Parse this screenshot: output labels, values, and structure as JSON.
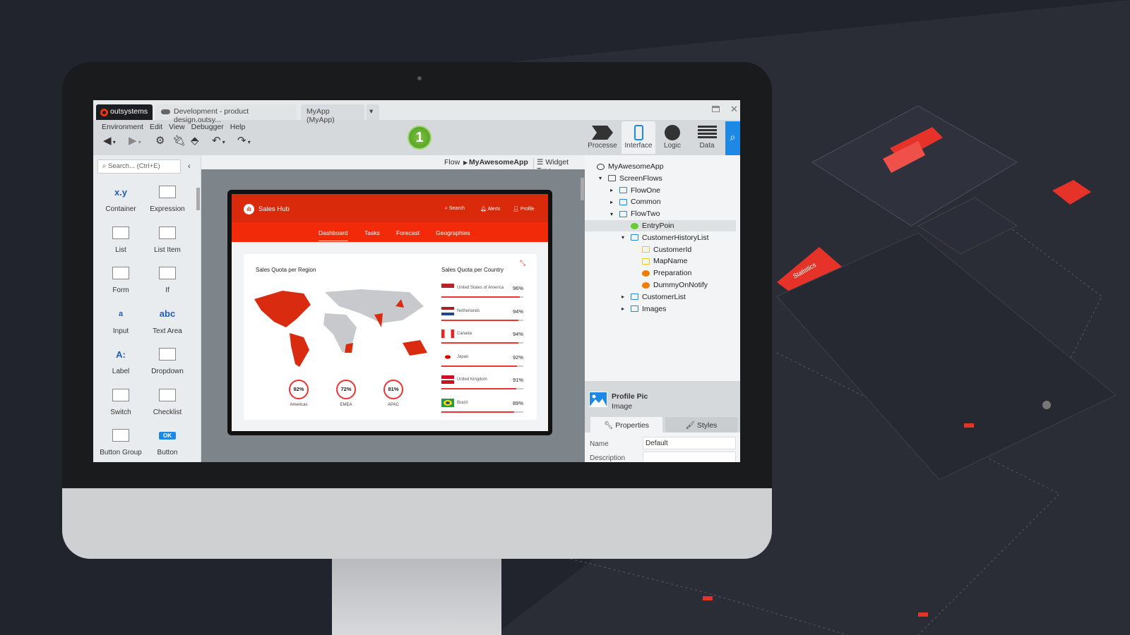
{
  "window": {
    "tabs": [
      "outsystems",
      "Development - product design.outsy...",
      "MyApp (MyApp)"
    ]
  },
  "menu": [
    "Environment",
    "Edit",
    "View",
    "Debugger",
    "Help"
  ],
  "badge": "1",
  "modules": [
    {
      "label": "Processe",
      "icon": "process-icon"
    },
    {
      "label": "Interface",
      "icon": "mobile-icon",
      "active": true
    },
    {
      "label": "Logic",
      "icon": "logic-circle-icon"
    },
    {
      "label": "Data",
      "icon": "grid-icon"
    }
  ],
  "search": {
    "placeholder": "Search... (Ctrl+E)"
  },
  "palette": [
    {
      "label": "Container",
      "glyph": "x.y"
    },
    {
      "label": "Expression",
      "glyph": ""
    },
    {
      "label": "List",
      "glyph": ""
    },
    {
      "label": "List Item",
      "glyph": ""
    },
    {
      "label": "Form",
      "glyph": ""
    },
    {
      "label": "If",
      "glyph": ""
    },
    {
      "label": "Input",
      "glyph": "a"
    },
    {
      "label": "Text Area",
      "glyph": "abc"
    },
    {
      "label": "Label",
      "glyph": "A:"
    },
    {
      "label": "Dropdown",
      "glyph": ""
    },
    {
      "label": "Switch",
      "glyph": ""
    },
    {
      "label": "Checklist",
      "glyph": ""
    },
    {
      "label": "Button Group",
      "glyph": ""
    },
    {
      "label": "Button",
      "glyph": "OK"
    }
  ],
  "breadcrumb": {
    "root": "Flow",
    "current": "MyAwesomeApp",
    "widget_tree": "Widget Tree"
  },
  "tree": [
    {
      "label": "MyAwesomeApp",
      "level": 0
    },
    {
      "label": "ScreenFlows",
      "level": 1
    },
    {
      "label": "FlowOne",
      "level": 2
    },
    {
      "label": "Common",
      "level": 2
    },
    {
      "label": "FlowTwo",
      "level": 2
    },
    {
      "label": "EntryPoin",
      "level": 3,
      "selected": true
    },
    {
      "label": "CustomerHistoryList",
      "level": 3
    },
    {
      "label": "CustomerId",
      "level": 4
    },
    {
      "label": "MapName",
      "level": 4
    },
    {
      "label": "Preparation",
      "level": 4
    },
    {
      "label": "DummyOnNotify",
      "level": 4
    },
    {
      "label": "CustomerList",
      "level": 3
    },
    {
      "label": "Images",
      "level": 3
    }
  ],
  "selection": {
    "name": "Profile Pic",
    "type": "Image"
  },
  "props_tabs": [
    "Properties",
    "Styles"
  ],
  "props": [
    {
      "label": "Name",
      "value": "Default"
    },
    {
      "label": "Description",
      "value": ""
    }
  ],
  "app": {
    "title": "Sales Hub",
    "actions": [
      "Search",
      "Alerts",
      "Profile"
    ],
    "nav": [
      "Dashboard",
      "Tasks",
      "Forecast",
      "Geographies"
    ],
    "region_title": "Sales Quota per Region",
    "country_title": "Sales Quota per Country",
    "regions": [
      {
        "name": "Americas",
        "value": "92%"
      },
      {
        "name": "EMEA",
        "value": "72%"
      },
      {
        "name": "APAC",
        "value": "81%"
      }
    ],
    "countries": [
      {
        "name": "United States of America",
        "value": "96%",
        "pct": 96
      },
      {
        "name": "Netherlands",
        "value": "94%",
        "pct": 94
      },
      {
        "name": "Canada",
        "value": "94%",
        "pct": 94
      },
      {
        "name": "Japan",
        "value": "92%",
        "pct": 92
      },
      {
        "name": "United Kingdom",
        "value": "91%",
        "pct": 91
      },
      {
        "name": "Brazil",
        "value": "89%",
        "pct": 89
      }
    ]
  },
  "colors": {
    "accent": "#da2a0c",
    "nav": "#f22a0a",
    "ide_blue": "#1e88e5",
    "bg": "#22242d"
  }
}
